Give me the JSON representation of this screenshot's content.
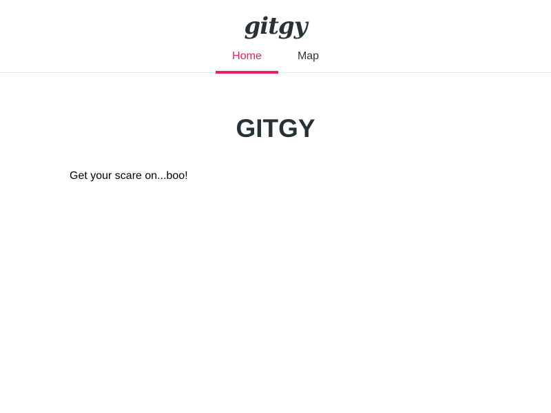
{
  "header": {
    "logo": "gitgy",
    "tabs": [
      {
        "label": "Home",
        "active": true
      },
      {
        "label": "Map",
        "active": false
      }
    ]
  },
  "main": {
    "title": "GITGY",
    "text": "Get your scare on...boo!"
  },
  "colors": {
    "accent": "#e91e63",
    "heading": "#263238"
  }
}
